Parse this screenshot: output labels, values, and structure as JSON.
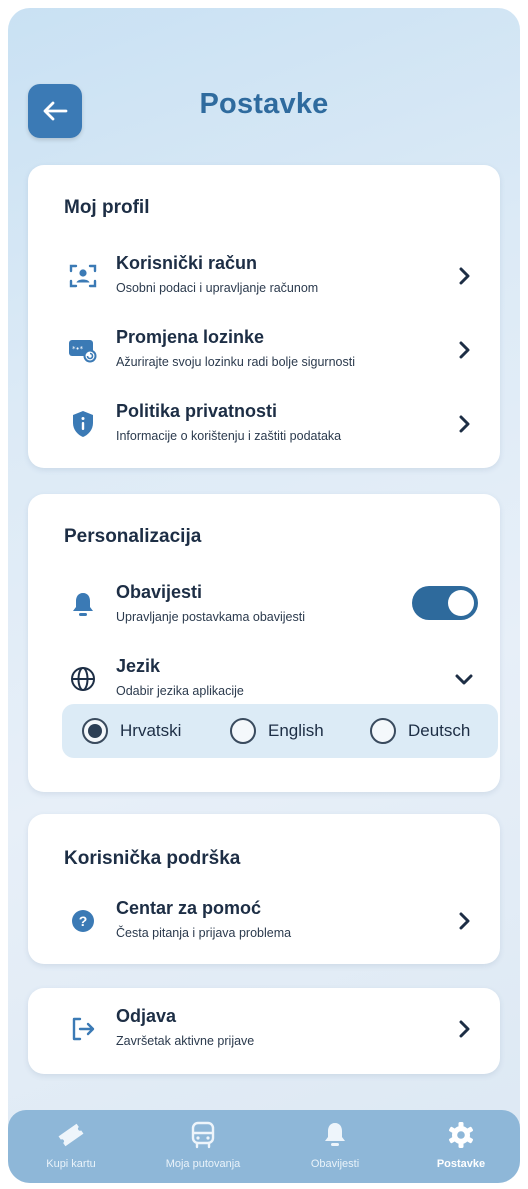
{
  "header": {
    "title": "Postavke",
    "back_icon": "arrow-left-icon"
  },
  "profile": {
    "title": "Moj profil",
    "items": [
      {
        "title": "Korisnički račun",
        "subtitle": "Osobni podaci i upravljanje računom",
        "icon": "user-account-icon"
      },
      {
        "title": "Promjena lozinke",
        "subtitle": "Ažurirajte svoju lozinku radi bolje sigurnosti",
        "icon": "password-change-icon"
      },
      {
        "title": "Politika privatnosti",
        "subtitle": "Informacije o korištenju i zaštiti podataka",
        "icon": "shield-icon"
      }
    ]
  },
  "personalization": {
    "title": "Personalizacija",
    "notifications": {
      "title": "Obavijesti",
      "subtitle": "Upravljanje postavkama obavijesti",
      "enabled": true
    },
    "language": {
      "title": "Jezik",
      "subtitle": "Odabir jezika aplikacije",
      "options": [
        "Hrvatski",
        "English",
        "Deutsch"
      ],
      "selected": "Hrvatski"
    }
  },
  "support": {
    "title": "Korisnička podrška",
    "items": [
      {
        "title": "Centar za pomoć",
        "subtitle": "Česta pitanja i prijava problema",
        "icon": "help-icon"
      }
    ]
  },
  "logout": {
    "title": "Odjava",
    "subtitle": "Završetak aktivne prijave",
    "icon": "logout-icon"
  },
  "tabbar": {
    "items": [
      {
        "label": "Kupi kartu",
        "icon": "ticket-icon"
      },
      {
        "label": "Moja putovanja",
        "icon": "bus-icon"
      },
      {
        "label": "Obavijesti",
        "icon": "bell-icon"
      },
      {
        "label": "Postavke",
        "icon": "gear-icon"
      }
    ],
    "active": "Postavke"
  },
  "colors": {
    "primary": "#2f6b9e",
    "accent_dark": "#1d2e45",
    "tabbar": "#8eb7d8",
    "card": "#ffffff"
  }
}
